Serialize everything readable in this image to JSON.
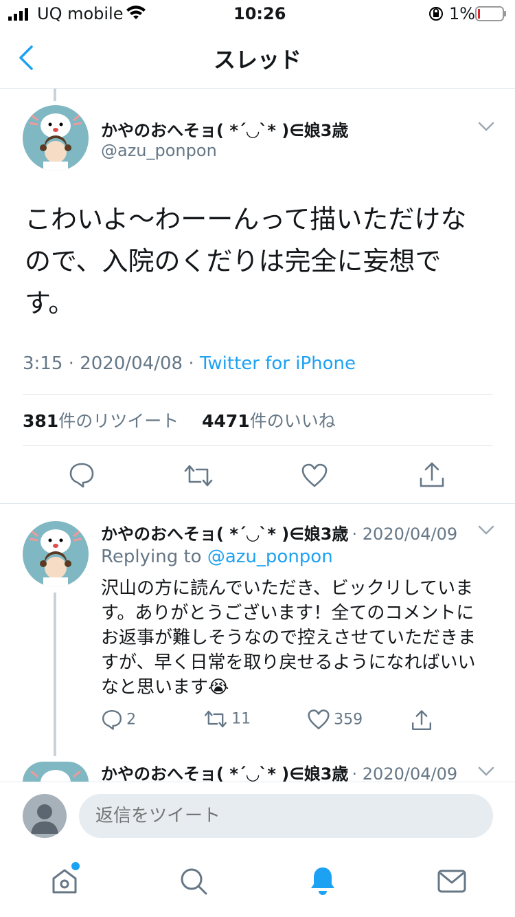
{
  "status_bar": {
    "carrier": "UQ mobile",
    "time": "10:26",
    "battery": "1%"
  },
  "nav": {
    "title": "スレッド"
  },
  "main_tweet": {
    "name": "かやのおへそョ( *´◡`* )∈娘3歳",
    "handle": "@azu_ponpon",
    "text_line1": "こわいよ〜わーーんって描いただけな",
    "text_line2": "ので、入院のくだりは完全に妄想で",
    "text_line3": "す。",
    "time": "3:15",
    "date": "2020/04/08",
    "sep": "·",
    "source": "Twitter for iPhone",
    "retweet_count": "381",
    "retweet_label": "件のリツイート",
    "like_count": "4471",
    "like_label": "件のいいね"
  },
  "reply_1": {
    "name": "かやのおへそョ( *´◡`* )∈娘3歳",
    "date": "· 2020/04/09",
    "replying_prefix": "Replying to",
    "replying_handle": "@azu_ponpon",
    "line1": "沢山の方に読んでいただき、ビックリしていま",
    "line2": "す。ありがとうございます！全てのコメントに",
    "line3": "お返事が難しそうなので控えさせていただきま",
    "line4": "すが、早く日常を取り戻せるようになればいい",
    "line5": "なと思います😭",
    "replies": "2",
    "retweets": "11",
    "likes": "359"
  },
  "reply_2": {
    "name": "かやのおへそョ( *´◡`* )∈娘3歳",
    "date": "· 2020/04/09"
  },
  "reply_bar": {
    "placeholder": "返信をツイート"
  },
  "tabs": [
    "home-icon",
    "search-icon",
    "notifications-icon",
    "messages-icon"
  ],
  "colors": {
    "accent": "#1da1f2",
    "muted": "#657786",
    "divider": "#e1e8ed",
    "notification_dot": "#1da1f2"
  }
}
